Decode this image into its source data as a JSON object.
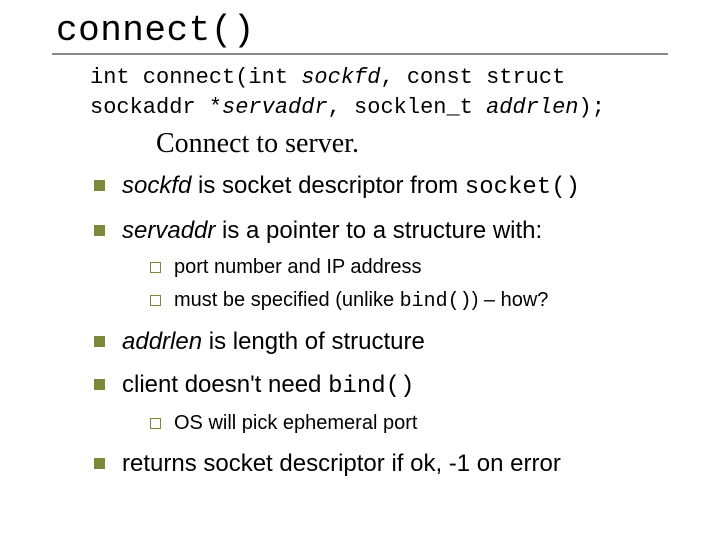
{
  "title": "connect()",
  "signature": {
    "prefix": "int connect(int ",
    "arg1": "sockfd",
    "mid1": ", const struct sockaddr *",
    "arg2": "servaddr",
    "mid2": ", socklen_t ",
    "arg3": "addrlen",
    "suffix": ");"
  },
  "subtitle": "Connect to server.",
  "bul1": {
    "arg": "sockfd",
    "rest": " is socket descriptor from ",
    "code": "socket()"
  },
  "bul2": {
    "arg": "servaddr",
    "rest": " is a pointer to a structure with:",
    "sub1": "port number and IP address",
    "sub2a": "must be specified (unlike ",
    "sub2code": "bind()",
    "sub2b": ") – how?"
  },
  "bul3": {
    "arg": "addrlen",
    "rest": " is length of structure"
  },
  "bul4": {
    "text": "client doesn't need ",
    "code": "bind()",
    "sub1": "OS will pick ephemeral port"
  },
  "bul5": "returns socket descriptor if ok, -1 on error"
}
